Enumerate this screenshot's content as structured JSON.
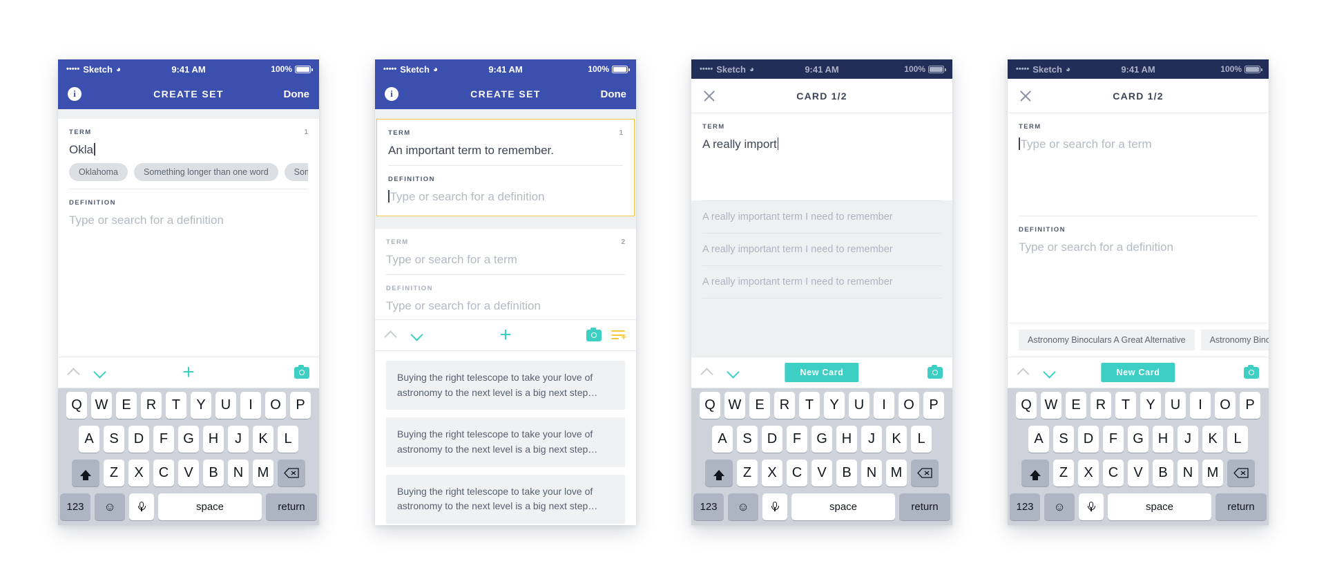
{
  "status_bar": {
    "dots": "•••••",
    "carrier": "Sketch",
    "wifi_icon": "wifi-icon",
    "time": "9:41 AM",
    "battery_percent": "100%"
  },
  "colors": {
    "brand_blue": "#3b4fae",
    "navy": "#222e58",
    "teal": "#3ecfc4",
    "yellow": "#f4c642",
    "keyboard_bg": "#ced3db"
  },
  "keyboard": {
    "row1": [
      "Q",
      "W",
      "E",
      "R",
      "T",
      "Y",
      "U",
      "I",
      "O",
      "P"
    ],
    "row2": [
      "A",
      "S",
      "D",
      "F",
      "G",
      "H",
      "J",
      "K",
      "L"
    ],
    "row3": [
      "Z",
      "X",
      "C",
      "V",
      "B",
      "N",
      "M"
    ],
    "shift_icon": "shift-icon",
    "backspace_icon": "backspace-icon",
    "numbers_label": "123",
    "emoji_icon": "emoji-icon",
    "mic_icon": "microphone-icon",
    "space_label": "space",
    "return_label": "return"
  },
  "phone1": {
    "nav": {
      "info_icon": "info-icon",
      "info_glyph": "i",
      "title": "CREATE SET",
      "done_label": "Done"
    },
    "card": {
      "term_label": "TERM",
      "card_number": "1",
      "term_value": "Okla",
      "definition_label": "DEFINITION",
      "definition_placeholder": "Type or search for a definition",
      "suggestions": [
        "Oklahoma",
        "Something longer than one word",
        "Some"
      ]
    },
    "toolbar": {
      "up_icon": "chevron-up-icon",
      "down_icon": "chevron-down-icon",
      "add_icon": "plus-icon",
      "camera_icon": "camera-icon"
    }
  },
  "phone2": {
    "nav": {
      "info_icon": "info-icon",
      "info_glyph": "i",
      "title": "CREATE SET",
      "done_label": "Done"
    },
    "card1": {
      "term_label": "TERM",
      "card_number": "1",
      "term_value": "An important term to remember.",
      "definition_label": "DEFINITION",
      "definition_placeholder": "Type or search for a definition"
    },
    "card2": {
      "term_label": "TERM",
      "card_number": "2",
      "term_placeholder": "Type or search for a term",
      "definition_label": "DEFINITION",
      "definition_placeholder": "Type or search for a definition"
    },
    "toolbar": {
      "up_icon": "chevron-up-icon",
      "down_icon": "chevron-down-icon",
      "add_icon": "plus-icon",
      "camera_icon": "camera-icon",
      "list_add_icon": "list-add-icon"
    },
    "suggestions": [
      "Buying the right telescope to take your love of astronomy to the next level is a big next step…",
      "Buying the right telescope to take your love of astronomy to the next level is a big next step…",
      "Buying the right telescope to take your love of astronomy to the next level is a big next step…"
    ]
  },
  "phone3": {
    "nav": {
      "close_icon": "close-icon",
      "title": "CARD 1/2"
    },
    "card": {
      "term_label": "TERM",
      "term_value": "A really import"
    },
    "search_results": [
      "A really important term I need to remember",
      "A really important term I need to remember",
      "A really important term I need to remember"
    ],
    "toolbar": {
      "up_icon": "chevron-up-icon",
      "down_icon": "chevron-down-icon",
      "new_card_label": "New Card",
      "camera_icon": "camera-icon"
    }
  },
  "phone4": {
    "nav": {
      "close_icon": "close-icon",
      "title": "CARD 1/2"
    },
    "card": {
      "term_label": "TERM",
      "term_placeholder": "Type or search for a term",
      "definition_label": "DEFINITION",
      "definition_placeholder": "Type or search for a definition"
    },
    "term_chips": [
      "Astronomy Binoculars A Great Alternative",
      "Astronomy Binocu"
    ],
    "toolbar": {
      "up_icon": "chevron-up-icon",
      "down_icon": "chevron-down-icon",
      "new_card_label": "New Card",
      "camera_icon": "camera-icon"
    }
  }
}
